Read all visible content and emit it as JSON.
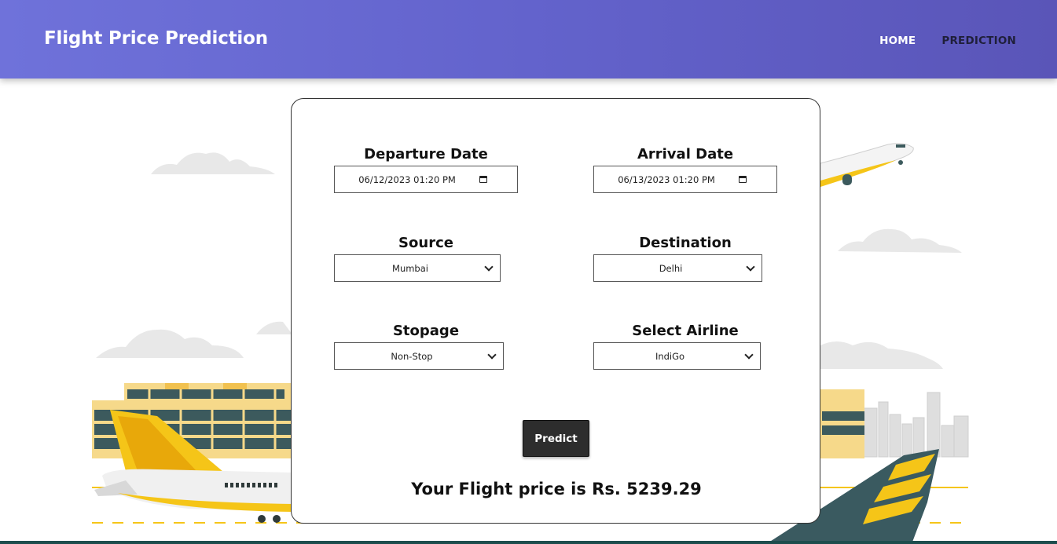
{
  "header": {
    "brand": "Flight Price Prediction",
    "nav": {
      "home": "HOME",
      "prediction": "PREDICTION"
    }
  },
  "form": {
    "departure": {
      "label": "Departure Date",
      "value": "06/12/2023 01:20  PM"
    },
    "arrival": {
      "label": "Arrival Date",
      "value": "06/13/2023 01:20  PM"
    },
    "source": {
      "label": "Source",
      "value": "Mumbai"
    },
    "destination": {
      "label": "Destination",
      "value": "Delhi"
    },
    "stopage": {
      "label": "Stopage",
      "value": "Non-Stop"
    },
    "airline": {
      "label": "Select Airline",
      "value": "IndiGo"
    },
    "predict_label": "Predict",
    "result_text": "Your Flight price is Rs. 5239.29"
  },
  "colors": {
    "header_gradient_start": "#6f72da",
    "header_gradient_end": "#5a55b8",
    "accent_yellow": "#f5c518",
    "tail_teal": "#3a5a60"
  },
  "icons": [
    "calendar-icon",
    "chevron-down-icon"
  ]
}
